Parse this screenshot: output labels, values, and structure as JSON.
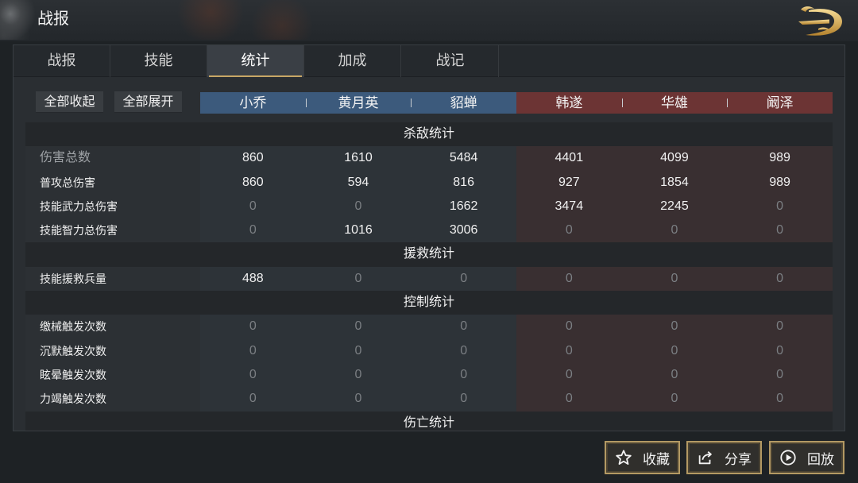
{
  "header": {
    "title": "战报"
  },
  "tabs": [
    {
      "label": "战报",
      "selected": false
    },
    {
      "label": "技能",
      "selected": false
    },
    {
      "label": "统计",
      "selected": true
    },
    {
      "label": "加成",
      "selected": false
    },
    {
      "label": "战记",
      "selected": false
    }
  ],
  "controls": {
    "collapse_all": "全部收起",
    "expand_all": "全部展开"
  },
  "teams": {
    "ally": {
      "color": "#3c5a7c",
      "generals": [
        "小乔",
        "黄月英",
        "貂蝉"
      ]
    },
    "enemy": {
      "color": "#6c3434",
      "generals": [
        "韩遂",
        "华雄",
        "阚泽"
      ]
    }
  },
  "sections": [
    {
      "title": "杀敌统计",
      "rows": [
        {
          "label": "伤害总数",
          "muted": true,
          "values": [
            860,
            1610,
            5484,
            4401,
            4099,
            989
          ]
        },
        {
          "label": "普攻总伤害",
          "values": [
            860,
            594,
            816,
            927,
            1854,
            989
          ]
        },
        {
          "label": "技能武力总伤害",
          "values": [
            0,
            0,
            1662,
            3474,
            2245,
            0
          ]
        },
        {
          "label": "技能智力总伤害",
          "values": [
            0,
            1016,
            3006,
            0,
            0,
            0
          ]
        }
      ]
    },
    {
      "title": "援救统计",
      "rows": [
        {
          "label": "技能援救兵量",
          "values": [
            488,
            0,
            0,
            0,
            0,
            0
          ]
        }
      ]
    },
    {
      "title": "控制统计",
      "rows": [
        {
          "label": "缴械触发次数",
          "values": [
            0,
            0,
            0,
            0,
            0,
            0
          ]
        },
        {
          "label": "沉默触发次数",
          "values": [
            0,
            0,
            0,
            0,
            0,
            0
          ]
        },
        {
          "label": "眩晕触发次数",
          "values": [
            0,
            0,
            0,
            0,
            0,
            0
          ]
        },
        {
          "label": "力竭触发次数",
          "values": [
            0,
            0,
            0,
            0,
            0,
            0
          ]
        }
      ]
    },
    {
      "title": "伤亡统计",
      "rows": []
    }
  ],
  "actions": {
    "favorite": {
      "label": "收藏",
      "icon": "star-icon"
    },
    "share": {
      "label": "分享",
      "icon": "share-icon"
    },
    "replay": {
      "label": "回放",
      "icon": "replay-icon"
    }
  },
  "icons": {
    "logo": "dragon-logo-icon"
  },
  "colors": {
    "accent_gold": "#c8a765",
    "button_border": "#b39963"
  }
}
